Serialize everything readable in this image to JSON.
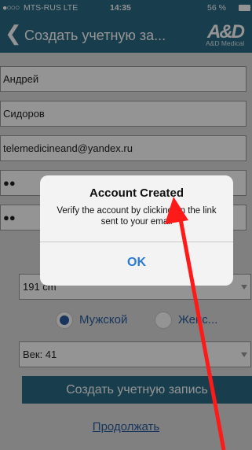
{
  "status_bar": {
    "carrier": "MTS-RUS  LTE",
    "time": "14:35",
    "battery": "56 %"
  },
  "nav": {
    "back_icon": "chevron-left-icon",
    "title": "Создать учетную за...",
    "logo_mark": "A&D",
    "logo_sub": "A&D Medical"
  },
  "form": {
    "first_name": "Андрей",
    "last_name": "Сидоров",
    "email": "telemedicineand@yandex.ru",
    "height": "191 cm",
    "gender_options": [
      "Мужской",
      "Женс..."
    ],
    "gender_selected": "Мужской",
    "age": "Век: 41",
    "create_button": "Создать учетную запись",
    "continue_link": "Продолжать"
  },
  "dialog": {
    "title": "Account Created",
    "message": "Verify the account by clicking on the link sent to your email",
    "ok_button": "OK"
  },
  "colors": {
    "accent": "#2a6a86",
    "link": "#2a5da0",
    "annotation_arrow": "#ff1a1a"
  }
}
